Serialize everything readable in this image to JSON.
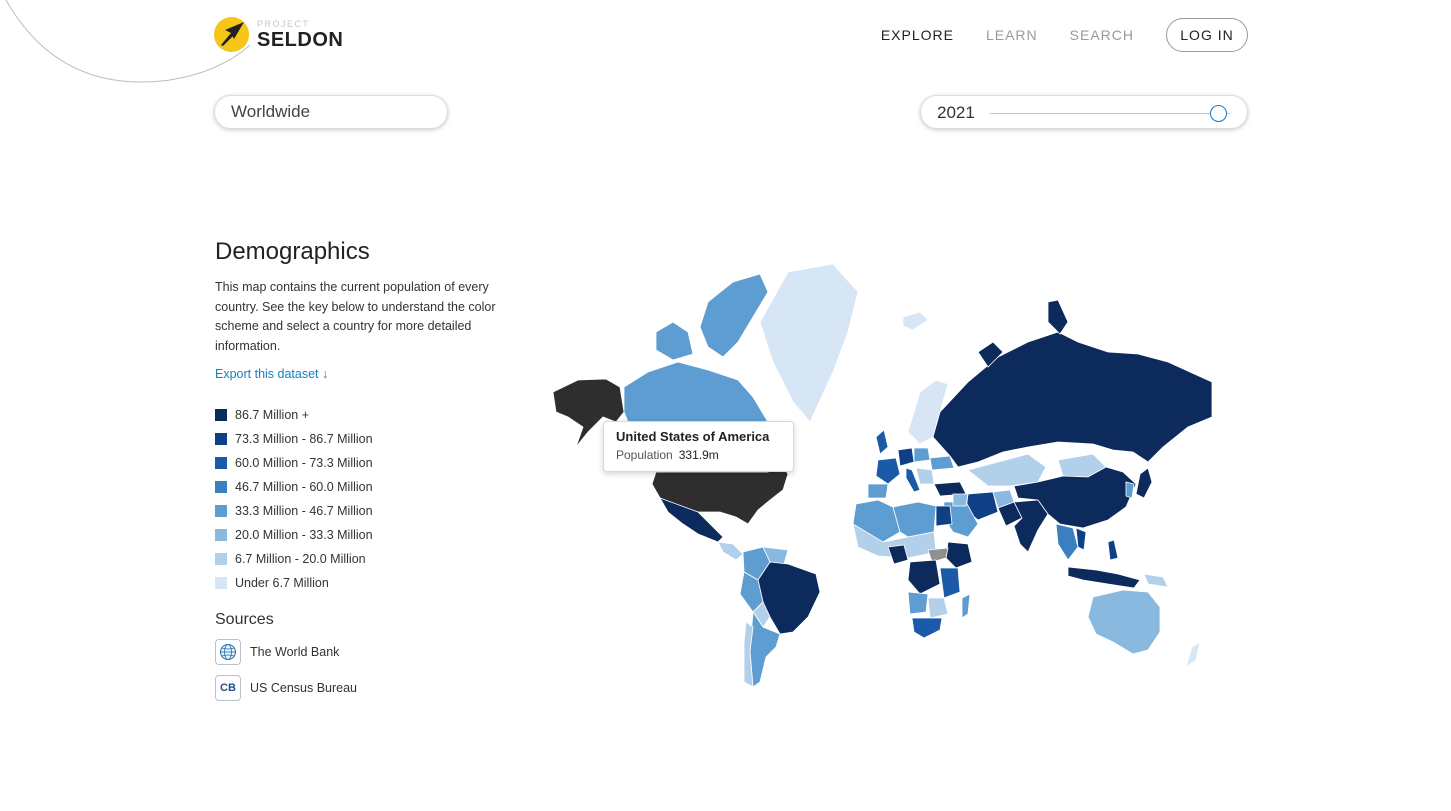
{
  "brand": {
    "small": "PROJECT",
    "name": "SELDON"
  },
  "nav": {
    "items": [
      {
        "label": "EXPLORE",
        "active": true
      },
      {
        "label": "LEARN",
        "active": false
      },
      {
        "label": "SEARCH",
        "active": false
      }
    ],
    "login": "LOG IN"
  },
  "controls": {
    "region": "Worldwide",
    "year": "2021",
    "year_slider_fraction": 0.95
  },
  "panel": {
    "title": "Demographics",
    "description": "This map contains the current population of every country. See the key below to understand the color scheme and select a country for more detailed information.",
    "export_label": "Export this dataset ↓",
    "legend": [
      {
        "label": "86.7 Million +",
        "color": "#0d2a5c"
      },
      {
        "label": "73.3 Million - 86.7 Million",
        "color": "#0f3f85"
      },
      {
        "label": "60.0 Million - 73.3 Million",
        "color": "#1a5aa8"
      },
      {
        "label": "46.7 Million - 60.0 Million",
        "color": "#3a7fc0"
      },
      {
        "label": "33.3 Million - 46.7 Million",
        "color": "#5d9dd1"
      },
      {
        "label": "20.0 Million - 33.3 Million",
        "color": "#8ab9df"
      },
      {
        "label": "6.7 Million - 20.0 Million",
        "color": "#b3d0ea"
      },
      {
        "label": "Under 6.7 Million",
        "color": "#d6e6f5"
      }
    ],
    "sources_title": "Sources",
    "sources": [
      {
        "label": "The World Bank",
        "icon": "globe-icon"
      },
      {
        "label": "US Census Bureau",
        "icon": "census-bureau-icon",
        "icon_text": "CB"
      }
    ]
  },
  "map": {
    "highlight_color": "#2e2e2e",
    "no_data_color": "#8f8f8f"
  },
  "tooltip": {
    "country": "United States of America",
    "metric": "Population",
    "value": "331.9m"
  }
}
